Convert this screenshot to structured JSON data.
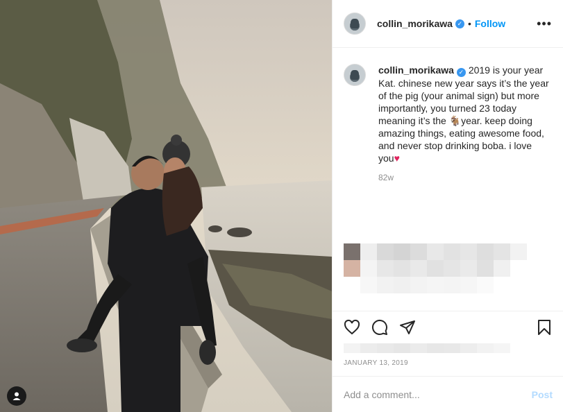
{
  "post": {
    "username": "collin_morikawa",
    "verified_icon": "verified-badge-icon",
    "separator": "•",
    "follow_label": "Follow",
    "more_icon": "more-options-icon"
  },
  "caption": {
    "username": "collin_morikawa",
    "text": "2019 is your year Kat. chinese new year says it’s the year of the pig (your animal sign) but more importantly, you turned 23 today meaning it’s the ",
    "goat_emoji": "🐐",
    "text2": "year. keep doing amazing things, eating awesome food, and never stop drinking boba. i love you",
    "heart_emoji": "❤️",
    "time_ago": "82w"
  },
  "actions": {
    "like_icon": "heart-icon",
    "comment_icon": "comment-icon",
    "share_icon": "share-icon",
    "save_icon": "bookmark-icon"
  },
  "date": "JANUARY 13, 2019",
  "add_comment": {
    "placeholder": "Add a comment...",
    "post_label": "Post"
  },
  "colors": {
    "link_blue": "#0095f6",
    "verified_blue": "#3897f0",
    "post_disabled": "#b3dbff"
  }
}
